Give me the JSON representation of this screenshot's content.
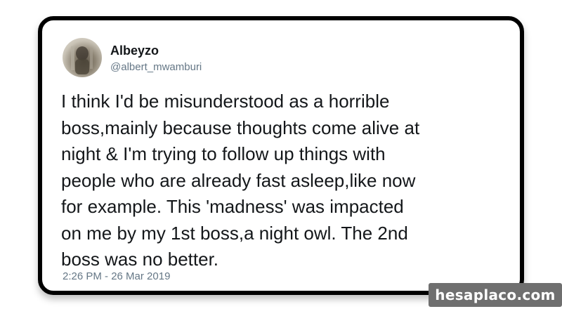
{
  "tweet": {
    "author_name": "Albeyzo",
    "author_handle": "@albert_mwamburi",
    "text": "I think I'd be misunderstood as a horrible\nboss,mainly because thoughts come alive at\nnight & I'm trying to follow up things with\npeople who are already fast asleep,like now\nfor example. This 'madness' was impacted\non me by my 1st boss,a night owl. The 2nd\nboss was no better.",
    "timestamp": "2:26 PM - 26 Mar 2019"
  },
  "watermark": {
    "text": "hesaplaco.com"
  },
  "icons": {
    "avatar": "profile-photo"
  },
  "colors": {
    "frame_border": "#000000",
    "name": "#14171a",
    "secondary_text": "#657786",
    "watermark_bg": "#6f6f6f"
  }
}
